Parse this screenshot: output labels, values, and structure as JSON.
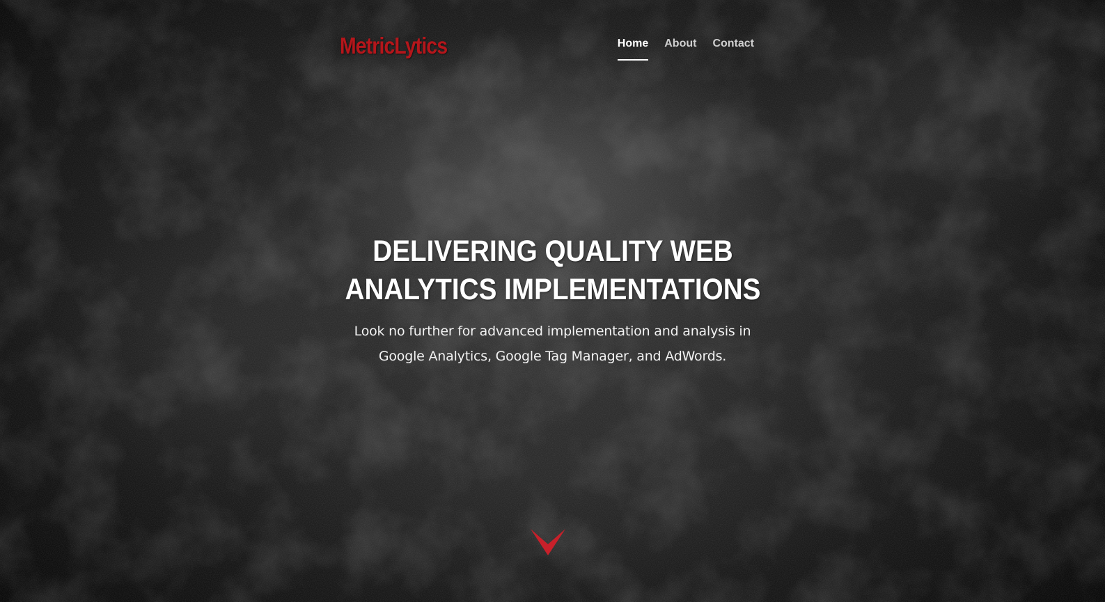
{
  "header": {
    "logo_text": "MetricLytics",
    "nav": [
      {
        "label": "Home",
        "active": true
      },
      {
        "label": "About",
        "active": false
      },
      {
        "label": "Contact",
        "active": false
      }
    ]
  },
  "hero": {
    "title_line1": "DELIVERING QUALITY WEB",
    "title_line2": "ANALYTICS IMPLEMENTATIONS",
    "subtitle_line1": "Look no further for advanced implementation and analysis in",
    "subtitle_line2": "Google Analytics, Google Tag Manager, and AdWords."
  },
  "scroll_icon": "chevron-down-icon",
  "colors": {
    "brand_red": "#b4161b",
    "arrow_red": "#c8202a",
    "text_white": "#ffffff",
    "nav_inactive": "#cfcfcf",
    "background_dark": "#1c1c1c"
  }
}
